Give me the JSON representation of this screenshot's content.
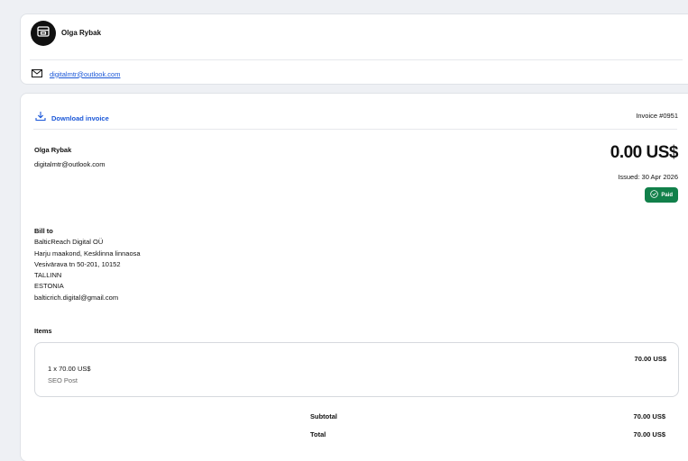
{
  "seller": {
    "name": "Olga Rybak",
    "email": "digitalmtr@outlook.com"
  },
  "invoice": {
    "download_label": "Download invoice",
    "number": "Invoice #0951",
    "from_name": "Olga Rybak",
    "from_email": "digitalmtr@outlook.com",
    "amount": "0.00 US$",
    "issued": "Issued: 30 Apr 2026",
    "status": "Paid",
    "status_color": "#11804a"
  },
  "bill_to": {
    "title": "Bill to",
    "lines": [
      "BalticReach Digital OÜ",
      "Harju maakond, Kesklinna linnaosa",
      "Vesivärava tn 50-201, 10152",
      "TALLINN",
      "ESTONIA",
      "balticrich.digital@gmail.com"
    ]
  },
  "items": {
    "title": "Items",
    "list": [
      {
        "qty_price": "1 x 70.00 US$",
        "description": "SEO Post",
        "total": "70.00 US$"
      }
    ]
  },
  "totals": {
    "subtotal_label": "Subtotal",
    "subtotal_value": "70.00 US$",
    "total_label": "Total",
    "total_value": "70.00 US$"
  },
  "colors": {
    "accent": "#1a57d8",
    "background": "#eef0f4"
  },
  "icons": [
    "store-icon",
    "mail-icon",
    "download-icon",
    "check-circle-icon"
  ]
}
